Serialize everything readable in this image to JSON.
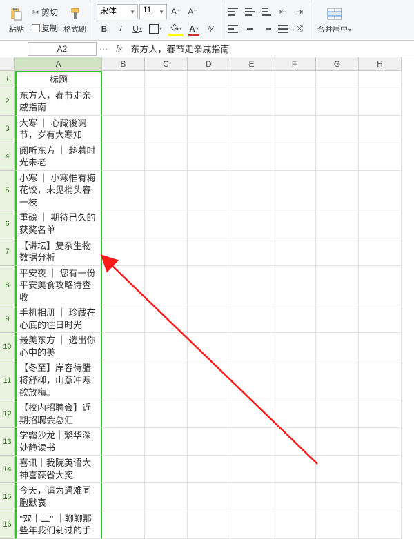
{
  "toolbar": {
    "paste": "粘贴",
    "cut": "剪切",
    "copy": "复制",
    "format_painter": "格式刷",
    "font_name": "宋体",
    "font_size": "11",
    "merge": "合并居中",
    "fill_color": "#ffff00",
    "font_color": "#d03030"
  },
  "namebox": "A2",
  "fx_label": "fx",
  "formula": "东方人，春节走亲戚指南",
  "columns": [
    "A",
    "B",
    "C",
    "D",
    "E",
    "F",
    "G",
    "H"
  ],
  "rows": [
    {
      "n": "1",
      "t": "标题",
      "head": true
    },
    {
      "n": "2",
      "t": "东方人，春节走亲戚指南"
    },
    {
      "n": "3",
      "t": "大寒 ｜ 心藏後凋节，岁有大寒知"
    },
    {
      "n": "4",
      "t": "阅听东方 ｜ 趁着时光未老"
    },
    {
      "n": "5",
      "t": "小寒 ｜ 小寒惟有梅花饺，未见梢头春一枝"
    },
    {
      "n": "6",
      "t": "重磅 ｜ 期待已久的获奖名单"
    },
    {
      "n": "7",
      "t": "【讲坛】复杂生物数据分析"
    },
    {
      "n": "8",
      "t": "平安夜 ｜ 您有一份平安美食攻略待查收"
    },
    {
      "n": "9",
      "t": "手机相册 ｜ 珍藏在心底的往日时光"
    },
    {
      "n": "10",
      "t": "最美东方 ｜ 选出你心中的美"
    },
    {
      "n": "11",
      "t": "【冬至】岸容待腊将舒柳，山意冲寒欲放梅。"
    },
    {
      "n": "12",
      "t": "【校内招聘会】近期招聘会总汇"
    },
    {
      "n": "13",
      "t": "学霸沙龙｜繁华深处静读书"
    },
    {
      "n": "14",
      "t": "喜讯｜我院英语大神喜获省大奖"
    },
    {
      "n": "15",
      "t": "今天，请为遇难同胞默哀"
    },
    {
      "n": "16",
      "t": "\"双十二\" ｜聊聊那些年我们剁过的手"
    }
  ]
}
